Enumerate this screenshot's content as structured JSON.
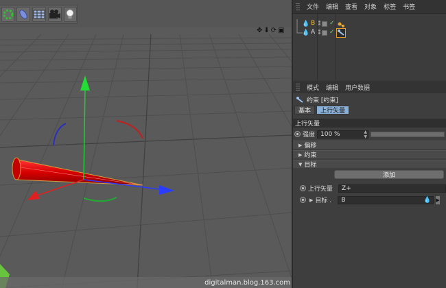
{
  "viewport": {
    "toolbar_icons": [
      "spline-green-icon",
      "nurbs-blue-icon",
      "floor-grid-icon",
      "camera-icon",
      "light-bulb-icon"
    ],
    "nav_icons": [
      "move-icon",
      "down-arrow-icon",
      "rotate-icon",
      "maximize-icon"
    ],
    "watermark": "digitalman.blog.163.com"
  },
  "object_manager": {
    "menu": [
      "文件",
      "编辑",
      "查看",
      "对象",
      "标签",
      "书签"
    ],
    "objects": [
      {
        "name": "B",
        "icon": "null-object-icon"
      },
      {
        "name": "A",
        "icon": "null-object-icon"
      }
    ]
  },
  "attribute_manager": {
    "menu": [
      "模式",
      "编辑",
      "用户数据"
    ],
    "title": "约束 [约束]",
    "tabs": [
      {
        "label": "基本",
        "active": false
      },
      {
        "label": "上行矢量",
        "active": true
      }
    ],
    "section": "上行矢量",
    "strength": {
      "label": "强度",
      "value": "100 %",
      "fraction": 1.0
    },
    "groups": [
      "偏移",
      "约束",
      "目标"
    ],
    "add_label": "添加",
    "up_vector": {
      "label": "上行矢量",
      "value": "Z+"
    },
    "target": {
      "label": "目标 .",
      "value": "B"
    }
  },
  "colors": {
    "accent_tab": "#8ab0d8",
    "cone": "#e01818",
    "axis_x": "#2a3cff",
    "axis_y": "#22cc33",
    "axis_z": "#e02020"
  }
}
